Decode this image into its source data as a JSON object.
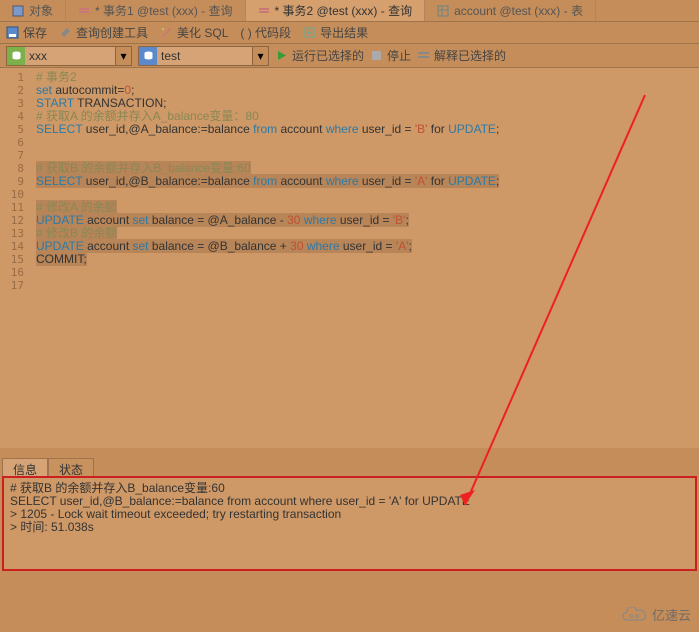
{
  "tabs": {
    "t0": {
      "icon": "object",
      "label": "对象"
    },
    "t1": {
      "icon": "query",
      "label": "* 事务1 @test (xxx) - 查询"
    },
    "t2": {
      "icon": "query",
      "label": "* 事务2 @test (xxx) - 查询"
    },
    "t3": {
      "icon": "table",
      "label": "account @test (xxx) - 表"
    }
  },
  "toolbar": {
    "save": "保存",
    "qbuilder": "查询创建工具",
    "beautify": "美化 SQL",
    "codegen": "( ) 代码段",
    "export": "导出结果"
  },
  "selectors": {
    "db": "xxx",
    "schema": "test",
    "run": "运行已选择的",
    "stop": "停止",
    "explain": "解释已选择的"
  },
  "code": {
    "l1": "# 事务2",
    "l2a": "set",
    "l2b": " autocommit=",
    "l2c": "0",
    "l2d": ";",
    "l3a": "START",
    "l3b": " TRANSACTION;",
    "l4": "# 获取A 的余额并存入A_balance变量：80",
    "l5a": "SELECT",
    "l5b": " user_id,@A_balance:=balance ",
    "l5c": "from",
    "l5d": " account ",
    "l5e": "where",
    "l5f": " user_id = ",
    "l5g": "'B'",
    "l5h": " for ",
    "l5i": "UPDATE",
    "l5j": ";",
    "l8": "# 获取B 的余额并存入B_balance变量:60",
    "l9a": "SELECT",
    "l9b": " user_id,@B_balance:=balance ",
    "l9c": "from",
    "l9d": " account ",
    "l9e": "where",
    "l9f": " user_id = ",
    "l9g": "'A'",
    "l9h": " for ",
    "l9i": "UPDATE",
    "l9j": ";",
    "l11": "# 修改A 的余额",
    "l12a": "UPDATE",
    "l12b": " account ",
    "l12c": "set",
    "l12d": " balance = @A_balance - ",
    "l12e": "30",
    "l12f": " where",
    "l12g": " user_id = ",
    "l12h": "'B'",
    "l12i": ";",
    "l13": "# 修改B 的余额",
    "l14a": "UPDATE",
    "l14b": " account ",
    "l14c": "set",
    "l14d": " balance = @B_balance + ",
    "l14e": "30",
    "l14f": " where",
    "l14g": " user_id = ",
    "l14h": "'A'",
    "l14i": ";",
    "l15": "COMMIT;"
  },
  "lines": {
    "n1": "1",
    "n2": "2",
    "n3": "3",
    "n4": "4",
    "n5": "5",
    "n6": "6",
    "n7": "7",
    "n8": "8",
    "n9": "9",
    "n10": "10",
    "n11": "11",
    "n12": "12",
    "n13": "13",
    "n14": "14",
    "n15": "15",
    "n16": "16",
    "n17": "17"
  },
  "bottomTabs": {
    "info": "信息",
    "status": "状态"
  },
  "output": {
    "l1": "# 获取B 的余额并存入B_balance变量:60",
    "l2": "SELECT user_id,@B_balance:=balance from account where user_id = 'A' for UPDATE",
    "l3": "> 1205 - Lock wait timeout exceeded; try restarting transaction",
    "l4": "> 时间: 51.038s"
  },
  "watermark": "亿速云"
}
